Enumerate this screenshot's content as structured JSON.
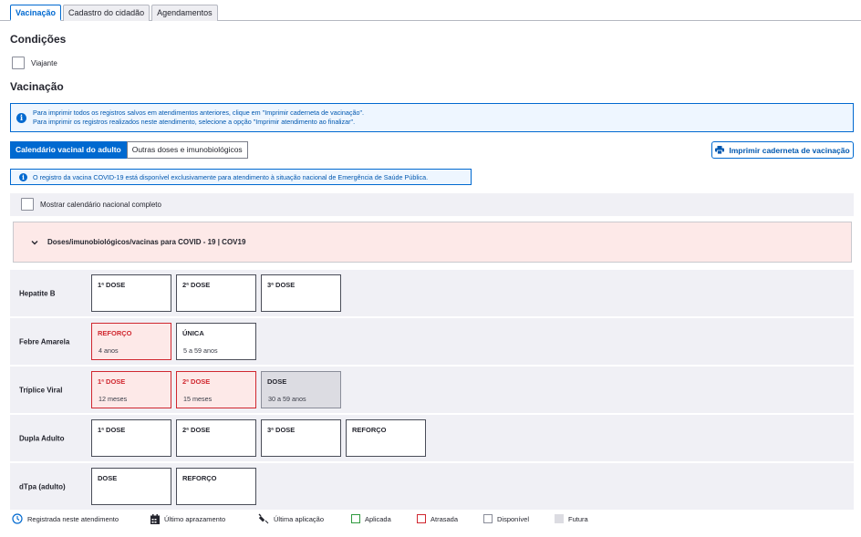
{
  "tabs": [
    "Vacinação",
    "Cadastro do cidadão",
    "Agendamentos"
  ],
  "condicoes": {
    "title": "Condições",
    "viajante_label": "Viajante"
  },
  "vacinacao": {
    "title": "Vacinação",
    "info_line1": "Para imprimir todos os registros salvos em atendimentos anteriores, clique em \"Imprimir caderneta de vacinação\".",
    "info_line2": "Para imprimir os registros realizados neste atendimento, selecione a opção \"Imprimir atendimento ao finalizar\".",
    "seg_tabs": [
      "Calendário vacinal do adulto",
      "Outras doses e imunobiológicos"
    ],
    "print_button": "Imprimir caderneta de vacinação",
    "covid_info": "O registro da vacina COVID-19 está disponível exclusivamente para atendimento à situação nacional de Emergência de Saúde Pública.",
    "show_full_calendar": "Mostrar calendário nacional completo",
    "covid_group": "Doses/imunobiológicos/vacinas para COVID - 19 | COV19"
  },
  "vaccines": [
    {
      "name": "Hepatite B",
      "doses": [
        {
          "title": "1ª DOSE",
          "sub": "",
          "status": "available"
        },
        {
          "title": "2ª DOSE",
          "sub": "",
          "status": "available"
        },
        {
          "title": "3ª DOSE",
          "sub": "",
          "status": "available"
        }
      ]
    },
    {
      "name": "Febre Amarela",
      "doses": [
        {
          "title": "REFORÇO",
          "sub": "4 anos",
          "status": "late"
        },
        {
          "title": "ÚNICA",
          "sub": "5 a 59 anos",
          "status": "available"
        }
      ]
    },
    {
      "name": "Tríplice Viral",
      "doses": [
        {
          "title": "1ª DOSE",
          "sub": "12 meses",
          "status": "late"
        },
        {
          "title": "2ª DOSE",
          "sub": "15 meses",
          "status": "late"
        },
        {
          "title": "DOSE",
          "sub": "30 a 59 anos",
          "status": "future"
        }
      ]
    },
    {
      "name": "Dupla Adulto",
      "doses": [
        {
          "title": "1ª DOSE",
          "sub": "",
          "status": "available"
        },
        {
          "title": "2ª DOSE",
          "sub": "",
          "status": "available"
        },
        {
          "title": "3ª DOSE",
          "sub": "",
          "status": "available"
        },
        {
          "title": "REFORÇO",
          "sub": "",
          "status": "available"
        }
      ]
    },
    {
      "name": "dTpa (adulto)",
      "doses": [
        {
          "title": "DOSE",
          "sub": "",
          "status": "available"
        },
        {
          "title": "REFORÇO",
          "sub": "",
          "status": "available"
        }
      ]
    }
  ],
  "legend": {
    "registrada": "Registrada neste atendimento",
    "ultimo_aprazamento": "Último aprazamento",
    "ultima_aplicacao": "Última aplicação",
    "aplicada": "Aplicada",
    "atrasada": "Atrasada",
    "disponivel": "Disponível",
    "futura": "Futura"
  },
  "colors": {
    "primary": "#0069d0",
    "late": "#d0272f",
    "applied": "#2e9a3e",
    "future": "#dcdce2"
  }
}
